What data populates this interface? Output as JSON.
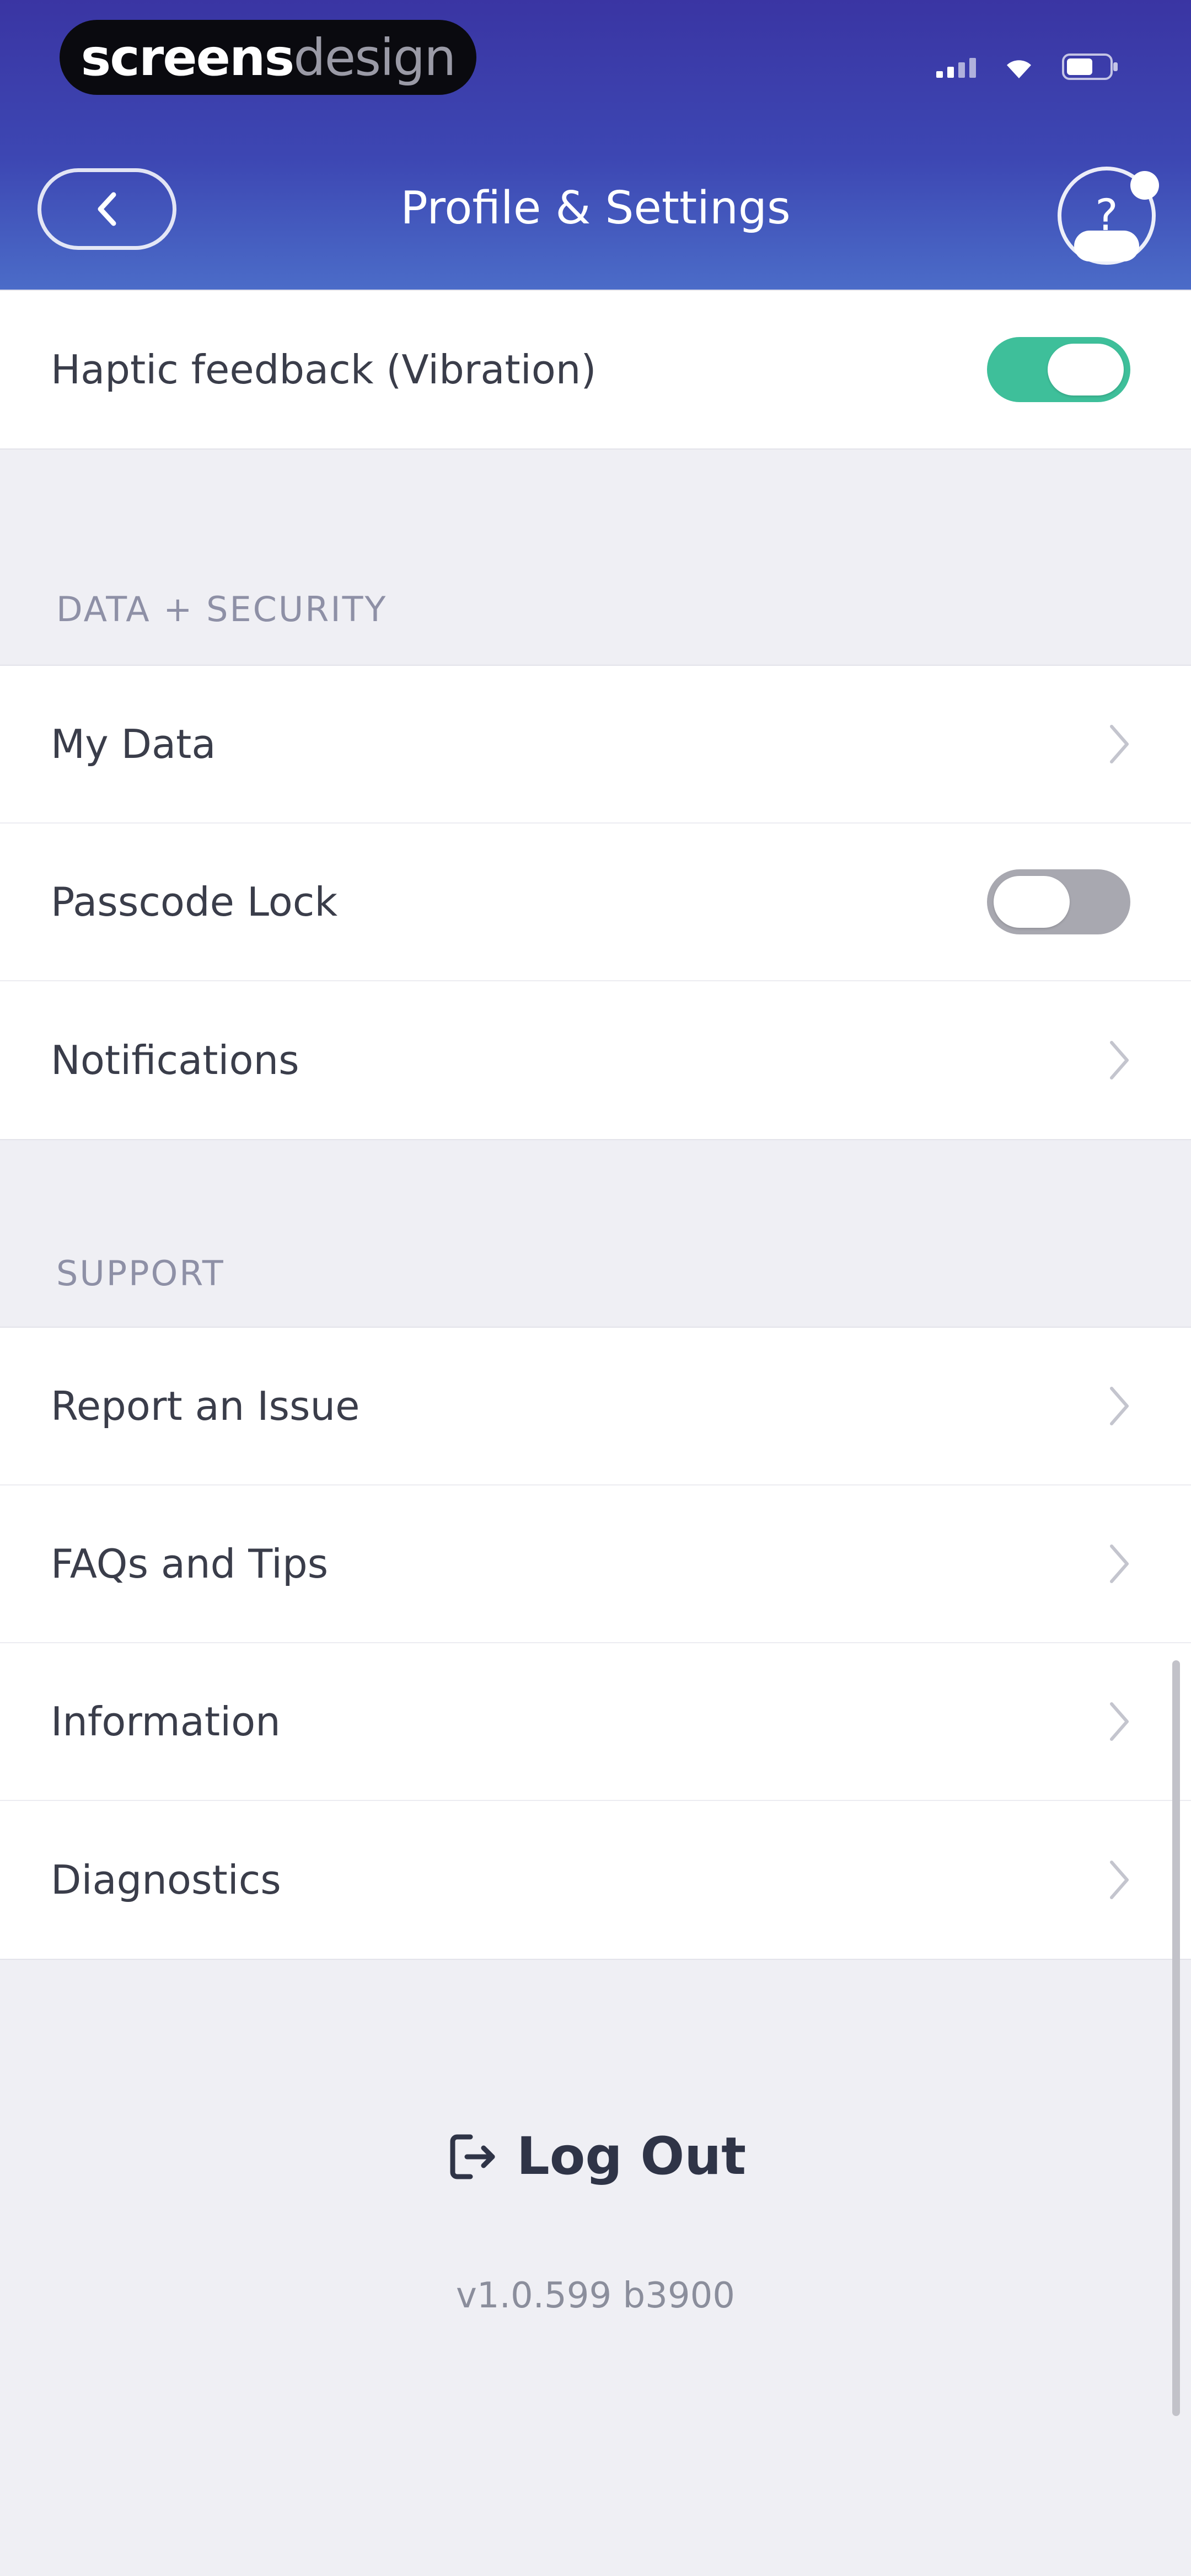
{
  "status_bar": {
    "brand_bold": "screens",
    "brand_light": "design",
    "signal_icon": "cellular-signal-icon",
    "wifi_icon": "wifi-icon",
    "battery_icon": "battery-icon"
  },
  "header": {
    "title": "Profile & Settings",
    "back_icon": "chevron-left-icon",
    "help_icon": "question-mark-icon",
    "help_glyph": "?"
  },
  "general": {
    "rows": [
      {
        "label": "Haptic feedback (Vibration)",
        "control": "toggle",
        "on": true
      }
    ]
  },
  "data_security": {
    "heading": "DATA + SECURITY",
    "rows": [
      {
        "label": "My Data",
        "control": "chevron"
      },
      {
        "label": "Passcode Lock",
        "control": "toggle",
        "on": false
      },
      {
        "label": "Notifications",
        "control": "chevron"
      }
    ]
  },
  "support": {
    "heading": "SUPPORT",
    "rows": [
      {
        "label": "Report an Issue",
        "control": "chevron"
      },
      {
        "label": "FAQs and Tips",
        "control": "chevron"
      },
      {
        "label": "Information",
        "control": "chevron"
      },
      {
        "label": "Diagnostics",
        "control": "chevron"
      }
    ]
  },
  "footer": {
    "logout_label": "Log Out",
    "logout_icon": "logout-icon",
    "version": "v1.0.599 b3900"
  },
  "colors": {
    "header_top": "#3a35a3",
    "header_bottom": "#4b6cc8",
    "toggle_on": "#3ebf9a",
    "toggle_off": "#a8a8b0",
    "background": "#efeff4"
  }
}
